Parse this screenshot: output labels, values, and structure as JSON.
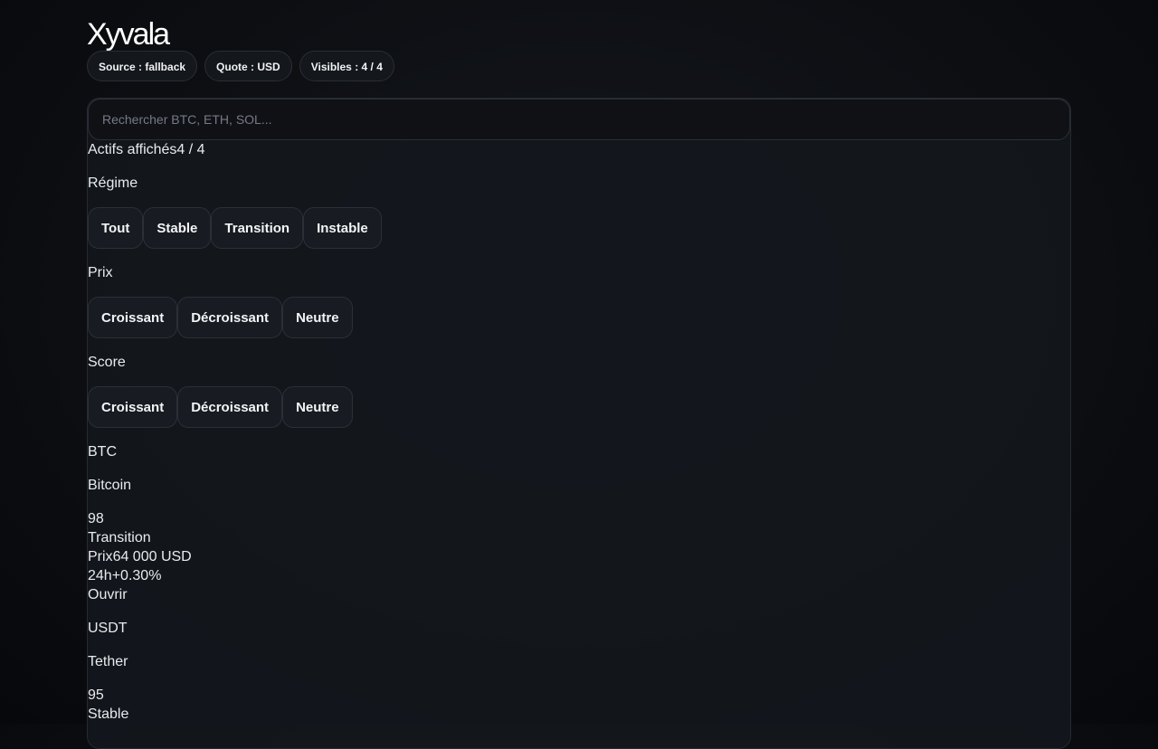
{
  "brand": "Xyvala",
  "pills": [
    "Source : fallback",
    "Quote : USD",
    "Visibles : 4 / 4"
  ],
  "search": {
    "placeholder": "Rechercher BTC, ETH, SOL..."
  },
  "shown": {
    "label": "Actifs affichés",
    "value": "4 / 4"
  },
  "filters": {
    "regime": {
      "label": "Régime",
      "options": [
        "Tout",
        "Stable",
        "Transition",
        "Instable"
      ]
    },
    "price": {
      "label": "Prix",
      "options": [
        "Croissant",
        "Décroissant",
        "Neutre"
      ]
    },
    "score": {
      "label": "Score",
      "options": [
        "Croissant",
        "Décroissant",
        "Neutre"
      ]
    }
  },
  "assets": [
    {
      "symbol": "BTC",
      "name": "Bitcoin",
      "score": "98",
      "regime": "Transition",
      "price_label": "Prix",
      "price": "64 000 USD",
      "change_label": "24h",
      "change": "+0.30%",
      "open_label": "Ouvrir"
    },
    {
      "symbol": "USDT",
      "name": "Tether",
      "score": "95",
      "regime": "Stable"
    }
  ]
}
